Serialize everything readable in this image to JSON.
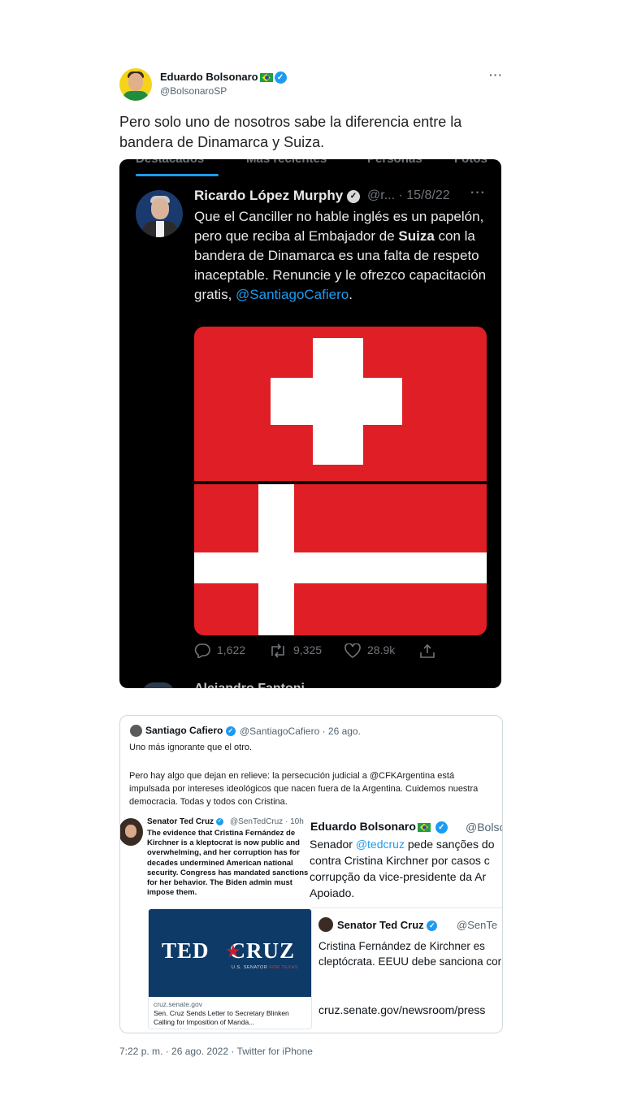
{
  "tweet": {
    "display_name": "Eduardo Bolsonaro",
    "handle": "@BolsonaroSP",
    "text": "Pero solo uno de nosotros sabe la diferencia entre la bandera de Dinamarca y Suiza.",
    "more": "···",
    "timestamp": "7:22 p. m. · 26 ago. 2022 · Twitter for iPhone"
  },
  "embedded_dark": {
    "tabs": [
      "Destacados",
      "Más recientes",
      "Personas",
      "Fotos"
    ],
    "author": "Ricardo López Murphy",
    "meta": "@r... · 15/8/22",
    "more": "···",
    "text_parts": {
      "p1": "Que el Canciller no hable inglés es un papelón, pero que reciba al Embajador de ",
      "bold": "Suiza",
      "p2": " con la bandera de Dinamarca es una falta de respeto inaceptable. Renuncie y le ofrezco capacitación gratis, ",
      "mention": "@SantiagoCafiero",
      "p3": "."
    },
    "replies": "1,622",
    "retweets": "9,325",
    "likes": "28.9k",
    "next_author": "Alejandro Fantoni"
  },
  "quoted": {
    "author": "Santiago Cafiero",
    "meta": "@SantiagoCafiero · 26 ago.",
    "line1": "Uno más ignorante que el otro.",
    "line2": "Pero hay algo que dejan en relieve: la persecución judicial a @CFKArgentina está impulsada por intereses ideológicos que nacen fuera de la Argentina. Cuidemos nuestra democracia. Todas y todos con Cristina.",
    "cruz": {
      "name": "Senator Ted Cruz",
      "handle": "@SenTedCruz · 10h",
      "text": "The evidence that Cristina Fernández de Kirchner is a kleptocrat is now public and overwhelming, and her corruption has for decades undermined American national security. Congress has mandated sanctions for her behavior. The Biden admin must impose them.",
      "logo_left": "TED",
      "logo_right": "CRUZ",
      "logo_sub": "U.S. SENATOR",
      "logo_sub_red": "FOR TEXAS",
      "domain": "cruz.senate.gov",
      "card_title": "Sen. Cruz Sends Letter to Secretary Blinken Calling for Imposition of Manda..."
    },
    "eduardo": {
      "name": "Eduardo Bolsonaro",
      "handle": "@Bolso...",
      "text_p1": "Senador ",
      "mention": "@tedcruz",
      "text_p2": " pede sanções do contra Cristina Kirchner por casos c corrupção da vice-presidente da Ar Apoiado.",
      "quote_name": "Senator Ted Cruz",
      "quote_handle": "@SenTe",
      "quote_text": "Cristina Fernández de Kirchner es cleptócrata. EEUU debe sanciona corrupta.",
      "quote_link": "cruz.senate.gov/newsroom/press"
    }
  },
  "colors": {
    "accent": "#1d9bf0",
    "flag_red": "#e01e25",
    "dark_bg": "#000000"
  }
}
